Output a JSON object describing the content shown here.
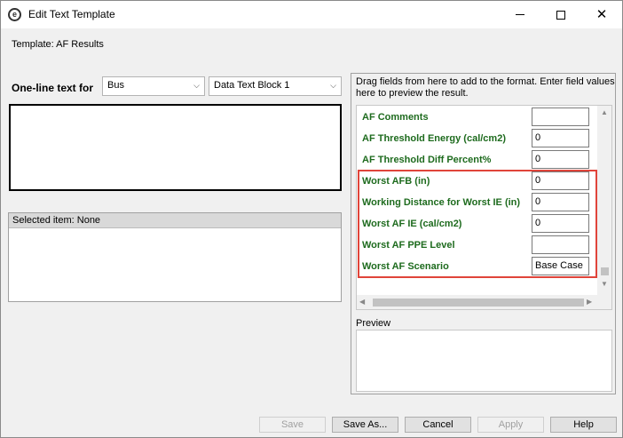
{
  "window": {
    "title": "Edit Text Template",
    "app_icon_glyph": "e",
    "controls": {
      "minimize": "minimize-icon",
      "maximize": "maximize-icon",
      "close": "close-icon"
    }
  },
  "template": {
    "text": "Template:  AF Results"
  },
  "oneline": {
    "label": "One-line text for",
    "object_type": "Bus",
    "block": "Data Text Block 1"
  },
  "selected": {
    "header": "Selected item: None"
  },
  "right": {
    "instructions": "Drag fields from here to add to the format.  Enter field values here to preview the result.",
    "fields": [
      {
        "label": "AF Comments",
        "value": ""
      },
      {
        "label": "AF Threshold Energy (cal/cm2)",
        "value": "0"
      },
      {
        "label": "AF Threshold Diff Percent%",
        "value": "0"
      },
      {
        "label": "Worst AFB (in)",
        "value": "0"
      },
      {
        "label": "Working Distance for Worst IE (in)",
        "value": "0"
      },
      {
        "label": "Worst AF IE (cal/cm2)",
        "value": "0"
      },
      {
        "label": "Worst AF PPE Level",
        "value": ""
      },
      {
        "label": "Worst AF Scenario",
        "value": "Base Case"
      }
    ],
    "preview_label": "Preview"
  },
  "buttons": {
    "save": "Save",
    "save_as": "Save As...",
    "cancel": "Cancel",
    "apply": "Apply",
    "help": "Help"
  },
  "colors": {
    "field_label": "#1e6b1e",
    "highlight": "#e0443a"
  }
}
